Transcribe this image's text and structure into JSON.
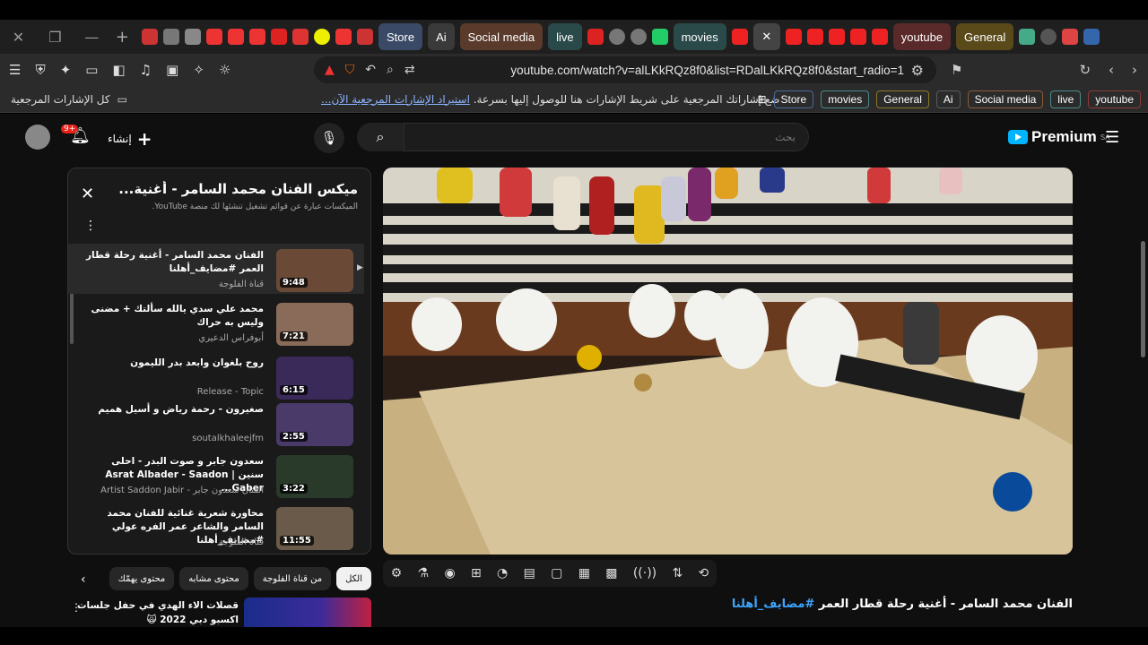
{
  "tabstrip": {
    "labeled_tabs": [
      {
        "label": "Store",
        "bg": "#3a4a66"
      },
      {
        "label": "Ai",
        "bg": "#3a3a3a"
      },
      {
        "label": "Social media",
        "bg": "#5a3a2a"
      },
      {
        "label": "live",
        "bg": "#2a4a4a"
      },
      {
        "label": "movies",
        "bg": "#2a4a4a"
      },
      {
        "label": "youtube",
        "bg": "#5a2a2a"
      },
      {
        "label": "General",
        "bg": "#5a4a1a"
      }
    ]
  },
  "address": {
    "url": "youtube.com/watch?v=alLKkRQz8f0&list=RDalLKkRQz8f0&start_radio=1"
  },
  "bookmarks": {
    "all_bookmarks": "كل الإشارات المرجعية",
    "message": "ضع إشاراتك المرجعية على شريط الإشارات هنا للوصول إليها بسرعة.",
    "import_link": "استيراد الإشارات المرجعية الآن...",
    "folders": [
      "Store",
      "movies",
      "General",
      "Ai",
      "Social media",
      "live",
      "youtube"
    ]
  },
  "youtube": {
    "logo_text": "Premium",
    "region": "SA",
    "search_placeholder": "بحث",
    "create_label": "إنشاء",
    "notification_badge": "9+",
    "playlist": {
      "title": "ميكس الفنان محمد السامر - أغنية...",
      "subtitle": "الميكسات عبارة عن قوائم تشغيل تنشئها لك منصة YouTube.",
      "items": [
        {
          "title": "الفنان محمد السامر - أغنية رحلة قطار العمر #مضايف_أهلنا",
          "channel": "قناة الفلوجة",
          "duration": "9:48",
          "thumb_color": "#6a4a36"
        },
        {
          "title": "محمد علي سدي يالله سألتك + مضنى وليس به حراك",
          "channel": "أبوفراس الدعيري",
          "duration": "7:21",
          "thumb_color": "#8a6a58"
        },
        {
          "title": "روح بلغوان وابعد بدر الليمون",
          "channel": "Release - Topic",
          "duration": "6:15",
          "thumb_color": "#3a2a5a"
        },
        {
          "title": "صغيرون - رحمة رياض و أسيل هميم",
          "channel": "soutalkhaleejfm",
          "duration": "2:55",
          "thumb_color": "#4a3a6a"
        },
        {
          "title": "سعدون جابر و صوت البدر - احلى سنين | Asrat Albader - Saadon Gaber...",
          "channel": "الفنان سعدون جابر - Artist Saddon Jabir",
          "duration": "3:22",
          "thumb_color": "#2a3a2a"
        },
        {
          "title": "محاورة شعرية غنائية للفنان محمد السامر والشاعر عمر الفره عولي #مضايف_أهلنا",
          "channel": "قناة الفلوجة",
          "duration": "11:55",
          "thumb_color": "#6a5a4a"
        }
      ]
    },
    "chips": [
      "الكل",
      "من قناة الفلوجة",
      "محتوى مشابه",
      "محتوى يهمّك"
    ],
    "recommendation": {
      "title": "قصلات الاء الهدي في حفل جلسات اكسبو دبي 2022 🙀"
    },
    "video": {
      "title": "الفنان محمد السامر - أغنية رحلة قطار العمر",
      "hashtag": "#مضايف_أهلنا"
    },
    "controls": [
      "gear-icon",
      "flask-icon",
      "camera-icon",
      "add-icon",
      "speed-icon",
      "captions-icon",
      "pip-icon",
      "clap-icon",
      "cam-icon",
      "audio-icon",
      "sort-icon",
      "loop-icon"
    ]
  }
}
